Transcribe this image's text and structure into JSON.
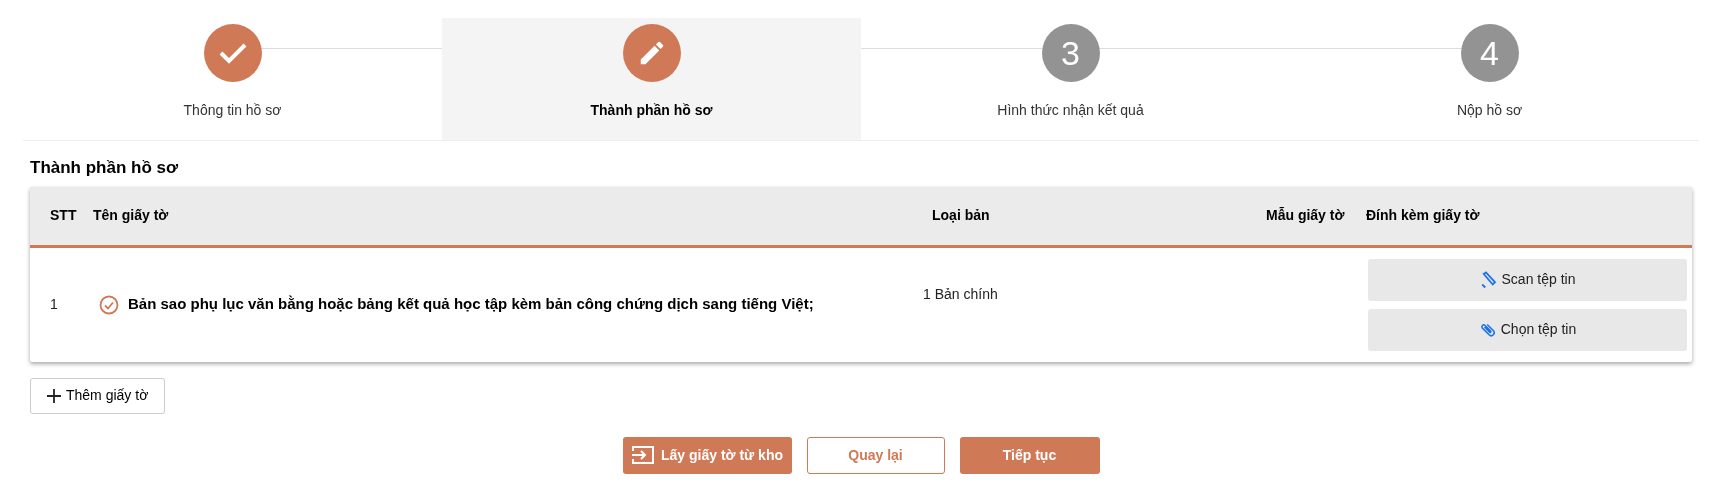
{
  "steps": [
    {
      "label": "Thông tin hồ sơ",
      "kind": "done",
      "selected": false
    },
    {
      "label": "Thành phần hồ sơ",
      "kind": "current",
      "selected": true
    },
    {
      "label": "Hình thức nhận kết quả",
      "number": "3",
      "kind": "pending",
      "selected": false
    },
    {
      "label": "Nộp hồ sơ",
      "number": "4",
      "kind": "pending",
      "selected": false
    }
  ],
  "section_title": "Thành phần hồ sơ",
  "table": {
    "columns": [
      "STT",
      "Tên giấy tờ",
      "Loại bản",
      "Mẫu giấy tờ",
      "Đính kèm giấy tờ"
    ],
    "rows": [
      {
        "index": "1",
        "name": "Bản sao phụ lục văn bằng hoặc bảng kết quả học tập kèm bản công chứng dịch sang tiếng Việt;",
        "completed": true,
        "copy_type": "1 Bản chính",
        "attach_buttons": [
          {
            "kind": "scan",
            "label": "Scan tệp tin"
          },
          {
            "kind": "choose",
            "label": "Chọn tệp tin"
          }
        ]
      }
    ]
  },
  "add_button": "Thêm giấy tờ",
  "actions": [
    {
      "kind": "import",
      "label": "Lấy giấy tờ từ kho"
    },
    {
      "kind": "back",
      "label": "Quay lại"
    },
    {
      "kind": "next",
      "label": "Tiếp tục"
    }
  ]
}
